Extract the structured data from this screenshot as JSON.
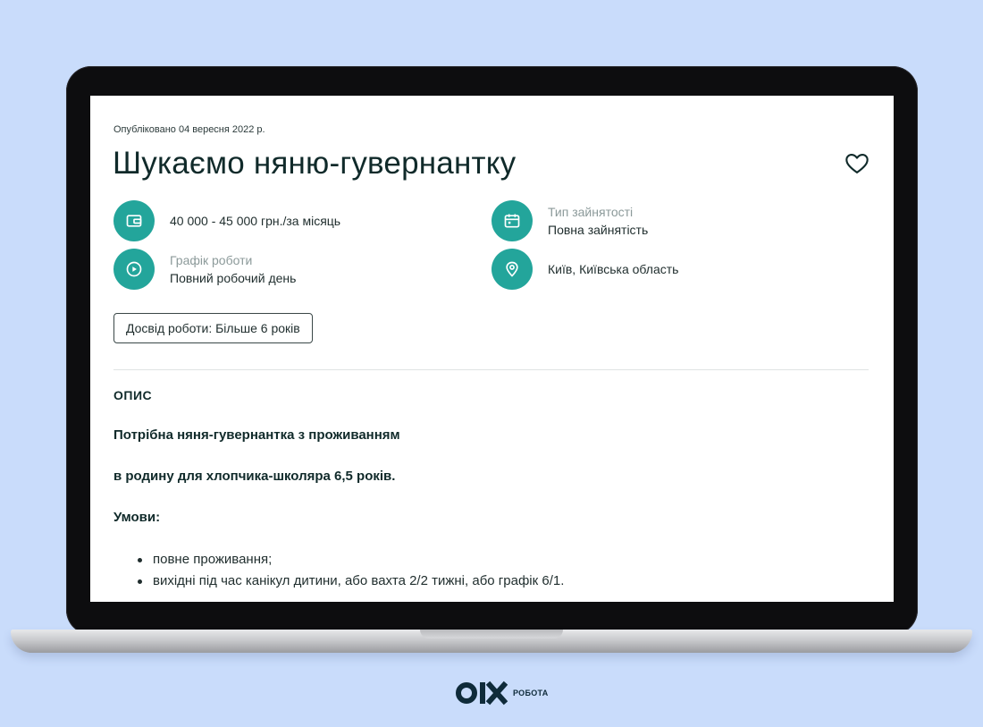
{
  "listing": {
    "published": "Опубліковано 04 вересня 2022 р.",
    "title": "Шукаємо няню-гувернантку",
    "salary": "40 000 - 45 000 грн./за місяць",
    "employment_type_label": "Тип зайнятості",
    "employment_type_value": "Повна зайнятість",
    "schedule_label": "Графік роботи",
    "schedule_value": "Повний робочий день",
    "location": "Київ, Київська область",
    "experience_chip": "Досвід роботи: Більше 6 років"
  },
  "description": {
    "heading": "ОПИС",
    "line1": "Потрібна няня-гувернантка з проживанням",
    "line2": "в родину для хлопчика-школяра 6,5 років.",
    "conditions_heading": "Умови:",
    "bullets": [
      "повне проживання;",
      "вихідні під час канікул дитини, або вахта 2/2 тижні, або графік 6/1."
    ]
  },
  "brand": {
    "logo_text": "OLX",
    "sub_label": "РОБОТА"
  },
  "icons": {
    "favorite": "heart-icon",
    "salary": "wallet-icon",
    "employment": "calendar-icon",
    "schedule": "play-circle-icon",
    "location": "location-pin-icon"
  },
  "colors": {
    "accent": "#23a59b",
    "background": "#c9dcfb",
    "text": "#102a2a"
  }
}
